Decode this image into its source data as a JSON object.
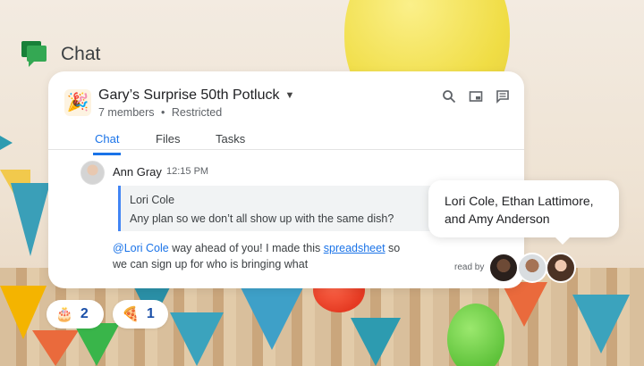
{
  "brand": {
    "title": "Chat",
    "icon": "google-chat-icon"
  },
  "space": {
    "emoji": "🎉",
    "title": "Gary’s Surprise 50th Potluck",
    "members": "7 members",
    "separator": "•",
    "access": "Restricted"
  },
  "header_icons": [
    "search-icon",
    "picture-in-picture-icon",
    "threads-icon"
  ],
  "tabs": [
    {
      "label": "Chat",
      "active": true
    },
    {
      "label": "Files",
      "active": false
    },
    {
      "label": "Tasks",
      "active": false
    }
  ],
  "message": {
    "sender": "Ann Gray",
    "time": "12:15 PM",
    "quote": {
      "author": "Lori Cole",
      "text": "Any plan so we don’t all show up with the same dish?"
    },
    "mention": "@Lori Cole",
    "text_before_link": " way ahead of you! I made this ",
    "link_text": "spreadsheet",
    "text_after_link": " so we can sign up for who is bringing what"
  },
  "read_by": {
    "label": "read by"
  },
  "tooltip": {
    "line1": "Lori Cole, Ethan Lattimore,",
    "line2": "and Amy Anderson"
  },
  "reactions": [
    {
      "emoji": "🎂",
      "count": "2"
    },
    {
      "emoji": "🍕",
      "count": "1"
    }
  ],
  "colors": {
    "accent": "#1a73e8",
    "brand_green": "#34a853",
    "quote_bar": "#4285f4"
  }
}
